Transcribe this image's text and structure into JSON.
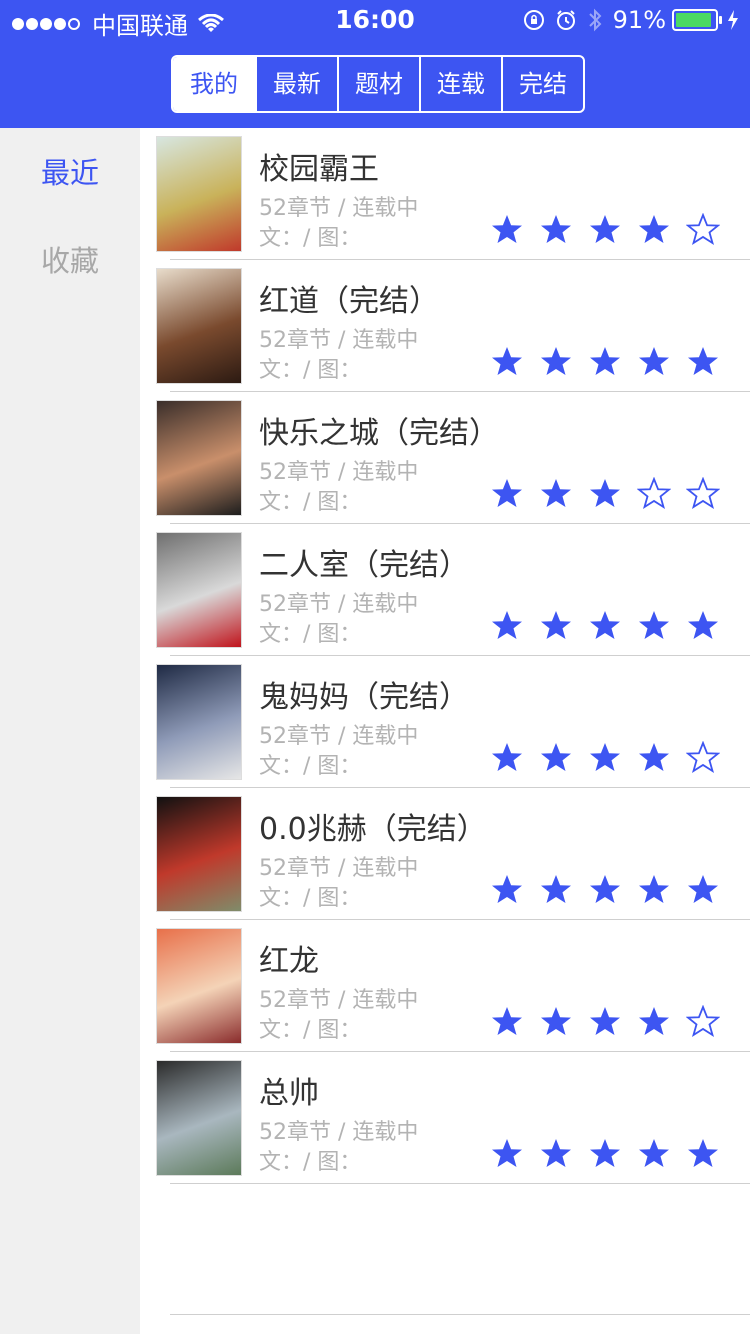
{
  "status_bar": {
    "carrier": "中国联通",
    "time": "16:00",
    "battery_percent": "91%",
    "battery_level": 0.91,
    "signal_bars": 4,
    "signal_max": 5
  },
  "tabs": [
    {
      "label": "我的",
      "active": true
    },
    {
      "label": "最新",
      "active": false
    },
    {
      "label": "题材",
      "active": false
    },
    {
      "label": "连载",
      "active": false
    },
    {
      "label": "完结",
      "active": false
    }
  ],
  "sidebar": {
    "items": [
      {
        "label": "最近",
        "active": true
      },
      {
        "label": "收藏",
        "active": false
      }
    ]
  },
  "comics": [
    {
      "title": "校园霸王",
      "meta": "52章节 / 连载中",
      "credits": "文：/ 图：",
      "rating": 4,
      "rating_max": 5,
      "cover": "comic-cover"
    },
    {
      "title": "红道（完结）",
      "meta": "52章节 / 连载中",
      "credits": "文：/ 图：",
      "rating": 5,
      "rating_max": 5,
      "cover": "comic-cover"
    },
    {
      "title": "快乐之城（完结）",
      "meta": "52章节 / 连载中",
      "credits": "文：/ 图：",
      "rating": 3,
      "rating_max": 5,
      "cover": "comic-cover"
    },
    {
      "title": "二人室（完结）",
      "meta": "52章节 / 连载中",
      "credits": "文：/ 图：",
      "rating": 5,
      "rating_max": 5,
      "cover": "comic-cover"
    },
    {
      "title": "鬼妈妈（完结）",
      "meta": "52章节 / 连载中",
      "credits": "文：/ 图：",
      "rating": 4,
      "rating_max": 5,
      "cover": "comic-cover"
    },
    {
      "title": "0.0兆赫（完结）",
      "meta": "52章节 / 连载中",
      "credits": "文：/ 图：",
      "rating": 5,
      "rating_max": 5,
      "cover": "comic-cover"
    },
    {
      "title": "红龙",
      "meta": "52章节 / 连载中",
      "credits": "文：/ 图：",
      "rating": 4,
      "rating_max": 5,
      "cover": "comic-cover"
    },
    {
      "title": "总帅",
      "meta": "52章节 / 连载中",
      "credits": "文：/ 图：",
      "rating": 5,
      "rating_max": 5,
      "cover": "comic-cover"
    }
  ],
  "colors": {
    "accent": "#3d55f2",
    "sidebar_bg": "#f0f0f0",
    "battery": "#4cd964"
  }
}
